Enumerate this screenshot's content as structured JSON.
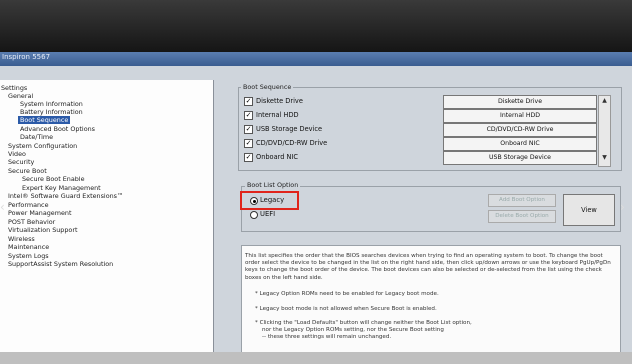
{
  "window": {
    "title": "Inspiron 5567"
  },
  "tree": [
    {
      "label": "Settings",
      "selected": false
    },
    {
      "label": "General",
      "selected": false
    },
    {
      "label": "System Information",
      "selected": false
    },
    {
      "label": "Battery Information",
      "selected": false
    },
    {
      "label": "Boot Sequence",
      "selected": true
    },
    {
      "label": "Advanced Boot Options",
      "selected": false
    },
    {
      "label": "Date/Time",
      "selected": false
    },
    {
      "label": "System Configuration",
      "selected": false
    },
    {
      "label": "Video",
      "selected": false
    },
    {
      "label": "Security",
      "selected": false
    },
    {
      "label": "Secure Boot",
      "selected": false
    },
    {
      "label": "Secure Boot Enable",
      "selected": false
    },
    {
      "label": "Expert Key Management",
      "selected": false
    },
    {
      "label": "Intel® Software Guard Extensions™",
      "selected": false
    },
    {
      "label": "Performance",
      "selected": false
    },
    {
      "label": "Power Management",
      "selected": false
    },
    {
      "label": "POST Behavior",
      "selected": false
    },
    {
      "label": "Virtualization Support",
      "selected": false
    },
    {
      "label": "Wireless",
      "selected": false
    },
    {
      "label": "Maintenance",
      "selected": false
    },
    {
      "label": "System Logs",
      "selected": false
    },
    {
      "label": "SupportAssist System Resolution",
      "selected": false
    }
  ],
  "boot_sequence": {
    "title": "Boot Sequence",
    "devices": [
      {
        "label": "Diskette Drive",
        "checked": true
      },
      {
        "label": "Internal HDD",
        "checked": true
      },
      {
        "label": "USB Storage Device",
        "checked": true
      },
      {
        "label": "CD/DVD/CD-RW Drive",
        "checked": true
      },
      {
        "label": "Onboard NIC",
        "checked": true
      }
    ],
    "order": [
      "Diskette Drive",
      "Internal HDD",
      "CD/DVD/CD-RW Drive",
      "Onboard NIC",
      "USB Storage Device"
    ]
  },
  "boot_list_option": {
    "title": "Boot List Option",
    "legacy": "Legacy",
    "uefi": "UEFI",
    "selected": "Legacy",
    "add_button": "Add Boot Option",
    "delete_button": "Delete Boot Option",
    "view_button": "View"
  },
  "info": {
    "paragraph": "This list specifies the order that the BIOS searches devices when trying to find an operating system to boot. To change the boot order select the device to be changed in the list on the right hand side, then click up/down arrows or use the keyboard PgUp/PgDn keys to change the boot order of the device. The boot devices can also be selected or de-selected from the list using the check boxes on the left hand side.",
    "note1": "* Legacy Option ROMs need to be enabled for Legacy boot mode.",
    "note2": "* Legacy boot mode is not allowed when Secure Boot is enabled.",
    "note3a": "* Clicking the \"Load Defaults\" button will change neither the Boot List option,",
    "note3b": "nor the Legacy Option ROMs setting, nor the Secure Boot setting",
    "note3c": "-- these three settings will remain unchanged."
  },
  "colors": {
    "selection": "#2b5aa8",
    "highlight_box": "#e0241b"
  }
}
